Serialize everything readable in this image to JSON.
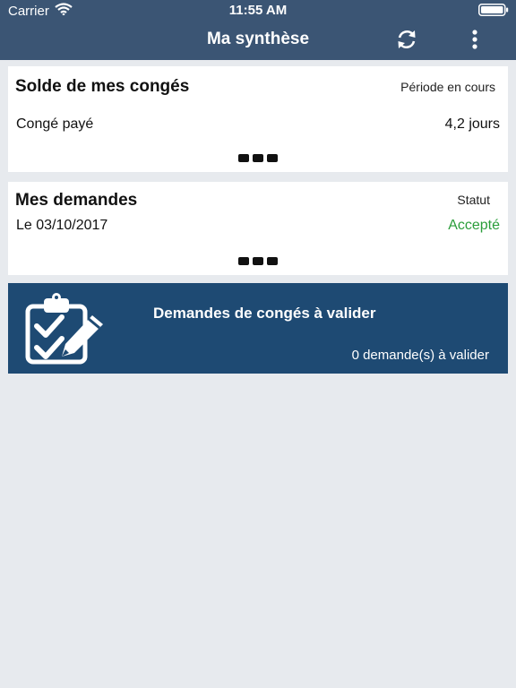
{
  "status_bar": {
    "carrier": "Carrier",
    "time": "11:55 AM",
    "wifi_icon": "wifi-icon",
    "battery_icon": "battery-icon"
  },
  "navbar": {
    "title": "Ma synthèse",
    "refresh_icon": "refresh-icon",
    "more_icon": "more-vertical-icon"
  },
  "leave_balance": {
    "title": "Solde de mes congés",
    "period": "Période en cours",
    "rows": [
      {
        "label": "Congé payé",
        "value": "4,2 jours"
      }
    ],
    "more_icon": "more-horizontal-icon"
  },
  "requests": {
    "title": "Mes demandes",
    "status_header": "Statut",
    "rows": [
      {
        "label": "Le 03/10/2017",
        "status": "Accepté"
      }
    ],
    "more_icon": "more-horizontal-icon"
  },
  "validation": {
    "title": "Demandes de congés à valider",
    "count_text": "0 demande(s) à valider",
    "icon": "clipboard-check-edit-icon"
  },
  "colors": {
    "header": "#3b5574",
    "banner": "#1e4a73",
    "background": "#e7eaee",
    "accepted": "#2a9d3a"
  }
}
